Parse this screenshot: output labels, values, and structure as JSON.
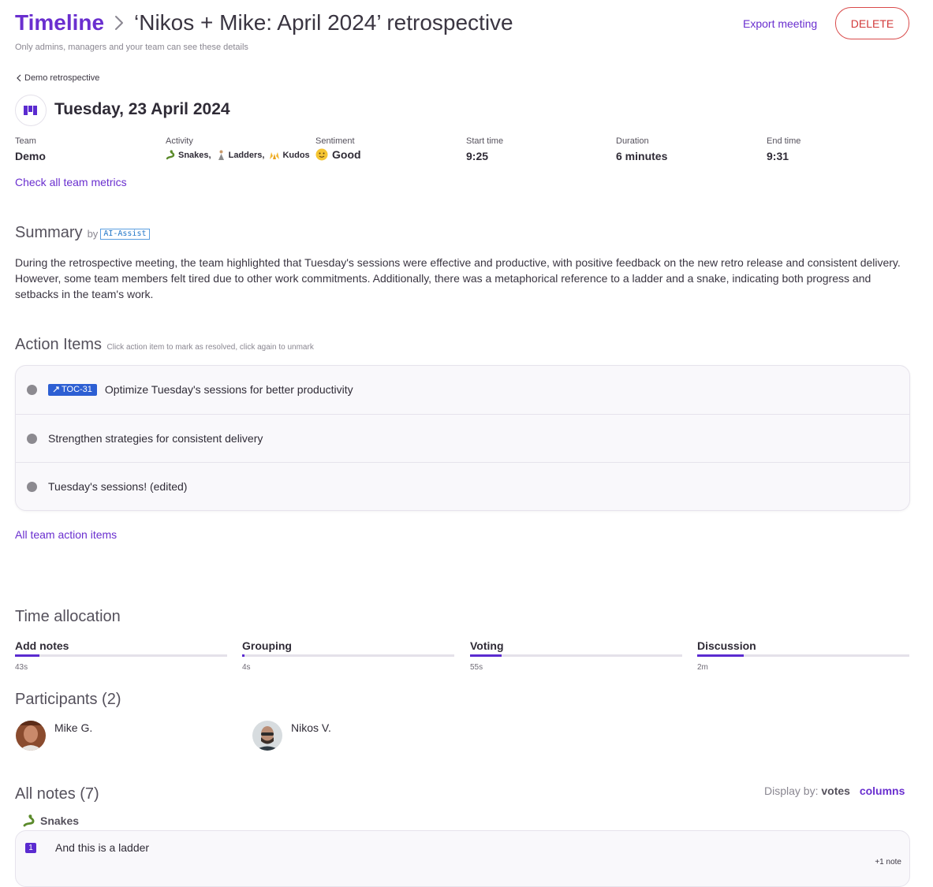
{
  "header": {
    "breadcrumb_root": "Timeline",
    "meeting_title": "‘Nikos + Mike: April 2024’ retrospective",
    "visibility_note": "Only admins, managers and your team can see these details",
    "export_label": "Export meeting",
    "delete_label": "DELETE"
  },
  "back_link": "Demo retrospective",
  "meeting": {
    "date": "Tuesday, 23 April 2024",
    "team_label": "Team",
    "team_value": "Demo",
    "activity_label": "Activity",
    "activities": [
      "Snakes,",
      "Ladders,",
      "Kudos"
    ],
    "sentiment_label": "Sentiment",
    "sentiment_value": "Good",
    "start_label": "Start time",
    "start_value": "9:25",
    "duration_label": "Duration",
    "duration_value": "6 minutes",
    "end_label": "End time",
    "end_value": "9:31",
    "metrics_link": "Check all team metrics"
  },
  "summary": {
    "title": "Summary",
    "by": "by",
    "badge": "AI-Assist",
    "text": "During the retrospective meeting, the team highlighted that Tuesday's sessions were effective and productive, with positive feedback on the new retro release and consistent delivery. However, some team members felt tired due to other work commitments. Additionally, there was a metaphorical reference to a ladder and a snake, indicating both progress and setbacks in the team's work."
  },
  "action_items": {
    "title": "Action Items",
    "hint": "Click action item to mark as resolved, click again to unmark",
    "items": [
      {
        "tag": "TOC-31",
        "text": "Optimize Tuesday's sessions for better productivity"
      },
      {
        "tag": "",
        "text": "Strengthen strategies for consistent delivery"
      },
      {
        "tag": "",
        "text": "Tuesday's sessions! (edited)"
      }
    ],
    "all_link": "All team action items"
  },
  "time_allocation": {
    "title": "Time allocation",
    "phases": [
      {
        "label": "Add notes",
        "value": "43s",
        "fraction": 0.115
      },
      {
        "label": "Grouping",
        "value": "4s",
        "fraction": 0.01
      },
      {
        "label": "Voting",
        "value": "55s",
        "fraction": 0.147
      },
      {
        "label": "Discussion",
        "value": "2m",
        "fraction": 0.218
      }
    ]
  },
  "participants": {
    "title": "Participants (2)",
    "people": [
      {
        "name": "Mike G."
      },
      {
        "name": "Nikos V."
      }
    ]
  },
  "notes": {
    "title": "All notes (7)",
    "display_by_label": "Display by:",
    "option_votes": "votes",
    "option_columns": "columns",
    "column_name": "Snakes",
    "first_note": {
      "votes": "1",
      "text": "And this is a ladder",
      "more": "+1 note"
    }
  },
  "colors": {
    "accent": "#6a2fcf",
    "danger": "#d23a3a",
    "tag_blue": "#2d5fd3",
    "bar_fill": "#5b2bd0"
  }
}
